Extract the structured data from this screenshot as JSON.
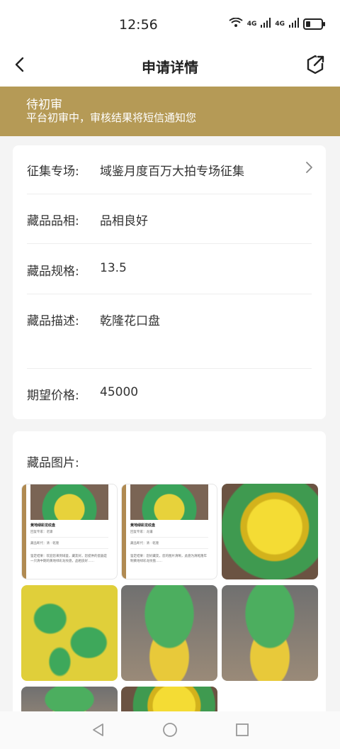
{
  "status_bar": {
    "time": "12:56",
    "net1": "4G",
    "net2": "4G",
    "sig1": "6"
  },
  "header": {
    "title": "申请详情"
  },
  "banner": {
    "status": "待初审",
    "message": "平台初审中，审核结果将短信通知您"
  },
  "details": [
    {
      "label": "征集专场:",
      "value": "域鉴月度百万大拍专场征集"
    },
    {
      "label": "藏品品相:",
      "value": "品相良好"
    },
    {
      "label": "藏品规格:",
      "value": "13.5"
    },
    {
      "label": "藏品描述:",
      "value": "乾隆花口盘"
    },
    {
      "label": "期望价格:",
      "value": "45000"
    }
  ],
  "images_section": {
    "title": "藏品图片:"
  },
  "thumbnails": [
    {
      "type": "doc",
      "doc_title": "黄地绿彩龙纹盘",
      "expert": "回复专家：老康",
      "era": "藏品断代：清 · 乾隆",
      "para": "鉴定结果：欢迎您来到域鉴，藏友好。您提供的瓷器是一只清中期的黄地绿彩龙纹盘，品相良好……"
    },
    {
      "type": "doc",
      "doc_title": "黄地绿彩龙纹盘",
      "expert": "回复专家：龙骧",
      "era": "藏品断代：清 · 乾隆",
      "para": "鉴定结果：您好藏友，您的图片清晰，此盘为清乾隆年制黄地绿彩龙纹盘……"
    },
    {
      "type": "plate"
    },
    {
      "type": "dragon"
    },
    {
      "type": "bowl"
    },
    {
      "type": "bowl"
    },
    {
      "type": "bowl"
    },
    {
      "type": "plate"
    }
  ]
}
